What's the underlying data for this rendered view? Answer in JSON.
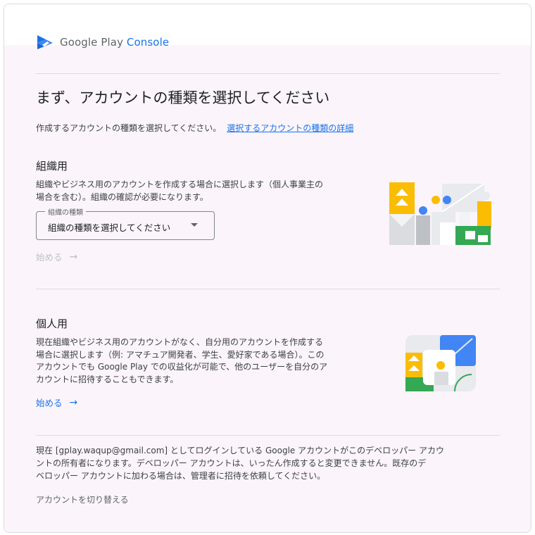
{
  "header": {
    "brand_google_play": "Google Play ",
    "brand_console": "Console"
  },
  "title": "まず、アカウントの種類を選択してください",
  "subtitle": {
    "text": "作成するアカウントの種類を選択してください。",
    "link": "選択するアカウントの種類の詳細"
  },
  "organization": {
    "heading": "組織用",
    "description_lines": [
      "組織やビジネス用のアカウントを作成する場合に選択します（個人事業主の",
      "場合を含む）。組織の確認が必要になります。"
    ],
    "select_label": "組織の種類",
    "select_value": "組織の種類を選択してください",
    "start_label": "始める"
  },
  "personal": {
    "heading": "個人用",
    "description_lines": [
      "現在組織やビジネス用のアカウントがなく、自分用のアカウントを作成する",
      "場合に選択します（例: アマチュア開発者、学生、愛好家である場合）。この",
      "アカウントでも Google Play での収益化が可能で、他のユーザーを自分のア",
      "カウントに招待することもできます。"
    ],
    "start_label": "始める"
  },
  "footer": {
    "lines": [
      "現在 [gplay.waqup@gmail.com] としてログインしている Google アカウントがこのデベロッパー アカウ",
      "ントの所有者になります。デベロッパー アカウントは、いったん作成すると変更できません。既存のデ",
      "ベロッパー アカウントに加わる場合は、管理者に招待を依頼してください。"
    ],
    "switch_account": "アカウントを切り替える"
  },
  "icons": {
    "arrow": "→"
  },
  "colors": {
    "accent": "#1a73e8",
    "disabled": "#bdc1c6",
    "background_tint": "#fbf5fb"
  }
}
